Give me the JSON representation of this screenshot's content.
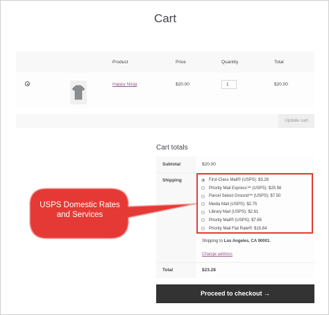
{
  "page": {
    "title": "Cart"
  },
  "cart_table": {
    "headers": {
      "product": "Product",
      "price": "Price",
      "quantity": "Quantity",
      "total": "Total"
    },
    "rows": [
      {
        "product_name": "Happy Ninja",
        "price": "$20.00",
        "quantity": "1",
        "total": "$20.00",
        "image_icon": "tshirt-icon",
        "remove_icon": "remove-icon"
      }
    ]
  },
  "actions": {
    "update_cart": "Update cart"
  },
  "totals": {
    "title": "Cart totals",
    "subtotal_label": "Subtotal",
    "subtotal_value": "$20.00",
    "shipping_label": "Shipping",
    "shipping_options": [
      {
        "label": "First-Class Mail® (USPS): $3.28",
        "selected": true
      },
      {
        "label": "Priority Mail Express™ (USPS): $25.56",
        "selected": false
      },
      {
        "label": "Parcel Select Ground™ (USPS): $7.50",
        "selected": false
      },
      {
        "label": "Media Mail (USPS): $2.75",
        "selected": false
      },
      {
        "label": "Library Mail (USPS): $2.61",
        "selected": false
      },
      {
        "label": "Priority Mail® (USPS): $7.65",
        "selected": false
      },
      {
        "label": "Priority Mail Flat Rate®: $15.64",
        "selected": false
      }
    ],
    "shipping_to_prefix": "Shipping to",
    "shipping_to_location": "Los Angeles, CA 90001.",
    "change_address": "Change address",
    "total_label": "Total",
    "total_value": "$23.28"
  },
  "checkout": {
    "label": "Proceed to checkout",
    "arrow_icon": "arrow-right-icon"
  },
  "annotation": {
    "text": "USPS Domestic Rates and Services",
    "color": "#e53935"
  },
  "colors": {
    "highlight": "#e53935",
    "link": "#96588a",
    "button": "#333333"
  }
}
